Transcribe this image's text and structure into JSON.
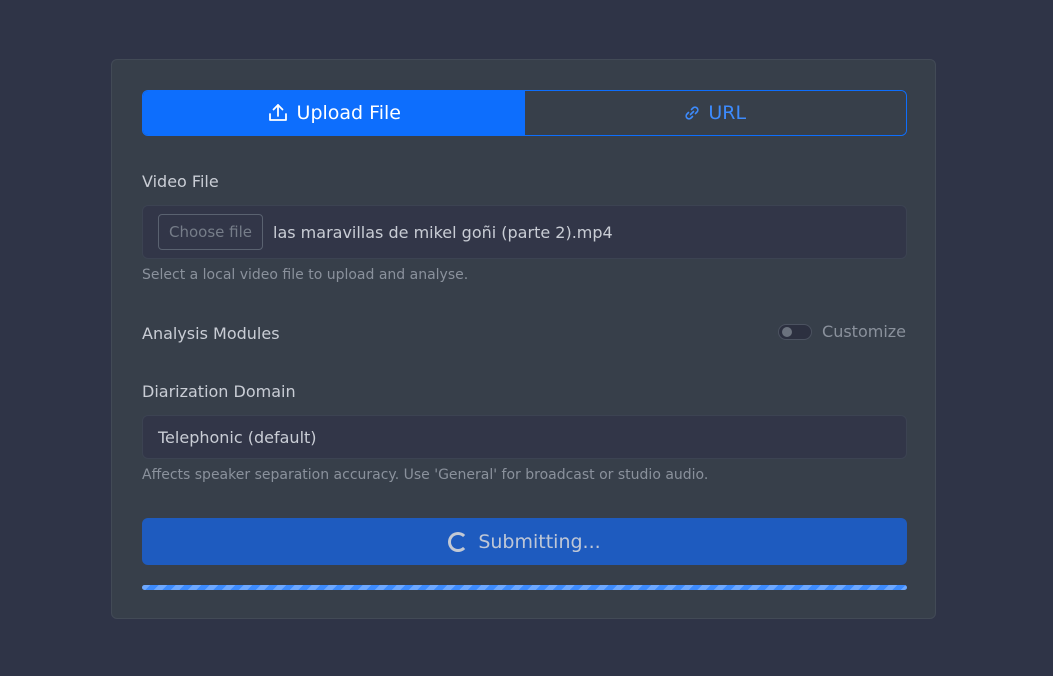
{
  "tabs": {
    "upload_label": "Upload File",
    "url_label": "URL",
    "upload_icon": "upload-icon",
    "url_icon": "link-icon"
  },
  "video_file": {
    "label": "Video File",
    "choose_button": "Choose file",
    "selected_file": "las maravillas de mikel goñi (parte 2).mp4",
    "help": "Select a local video file to upload and analyse."
  },
  "analysis_modules": {
    "label": "Analysis Modules",
    "toggle_label": "Customize",
    "toggle_on": false
  },
  "diarization": {
    "label": "Diarization Domain",
    "selected": "Telephonic (default)",
    "help": "Affects speaker separation accuracy. Use 'General' for broadcast or studio audio."
  },
  "submit": {
    "label": "Submitting...",
    "icon": "spinner-icon"
  },
  "progress": {
    "percent": 100
  },
  "colors": {
    "primary": "#0d6efd",
    "submit_bg": "#1e5bbf",
    "page_bg": "#2f3447",
    "card_bg": "#373f4a"
  }
}
